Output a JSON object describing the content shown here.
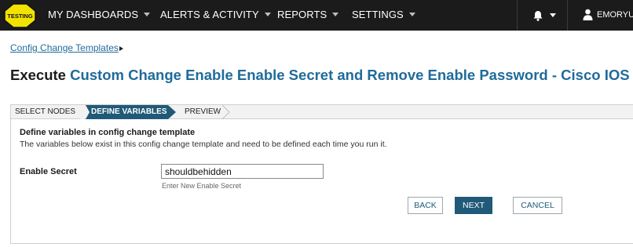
{
  "nav": {
    "logo_text": "TESTING",
    "items": [
      {
        "label": "MY DASHBOARDS"
      },
      {
        "label": "ALERTS & ACTIVITY"
      },
      {
        "label": "REPORTS"
      },
      {
        "label": "SETTINGS"
      }
    ],
    "user_name": "EMORYUN"
  },
  "breadcrumb": {
    "label": "Config Change Templates"
  },
  "page": {
    "title_verb": "Execute",
    "title_name": "Custom Change Enable Enable Secret and Remove Enable Password - Cisco IOS"
  },
  "wizard": {
    "steps": [
      {
        "label": "SELECT NODES"
      },
      {
        "label": "DEFINE VARIABLES"
      },
      {
        "label": "PREVIEW"
      }
    ],
    "active_step": "DEFINE VARIABLES",
    "heading": "Define variables in config change template",
    "description": "The variables below exist in this config change template and need to be defined each time you run it.",
    "field": {
      "label": "Enable Secret",
      "value": "shouldbehidden",
      "help": "Enter New Enable Secret"
    },
    "buttons": {
      "back": "BACK",
      "next": "NEXT",
      "cancel": "CANCEL"
    }
  },
  "colors": {
    "topbar": "#1b1b1b",
    "accent": "#205a78",
    "link": "#1f6b9a",
    "logo_yellow": "#f2e200"
  }
}
